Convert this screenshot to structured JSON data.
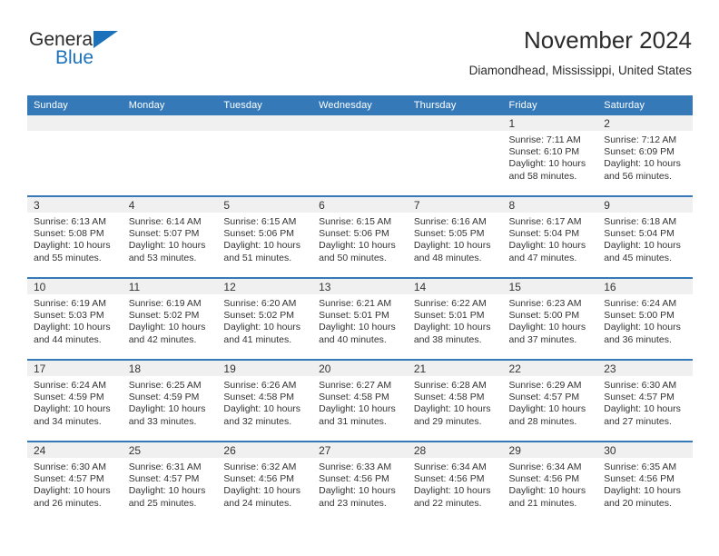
{
  "logo": {
    "word_top": "General",
    "word_bottom": "Blue",
    "triangle_color": "#1b72bb"
  },
  "header": {
    "title": "November 2024",
    "subtitle": "Diamondhead, Mississippi, United States"
  },
  "theme": {
    "header_blue": "#3579b8",
    "daybar_gray": "#f0f0f0",
    "text": "#333333"
  },
  "calendar": {
    "weekday_headers": [
      "Sunday",
      "Monday",
      "Tuesday",
      "Wednesday",
      "Thursday",
      "Friday",
      "Saturday"
    ],
    "labels": {
      "sunrise": "Sunrise:",
      "sunset": "Sunset:",
      "daylight": "Daylight:"
    },
    "weeks": [
      [
        {
          "day": "",
          "sunrise": "",
          "sunset": "",
          "daylight": ""
        },
        {
          "day": "",
          "sunrise": "",
          "sunset": "",
          "daylight": ""
        },
        {
          "day": "",
          "sunrise": "",
          "sunset": "",
          "daylight": ""
        },
        {
          "day": "",
          "sunrise": "",
          "sunset": "",
          "daylight": ""
        },
        {
          "day": "",
          "sunrise": "",
          "sunset": "",
          "daylight": ""
        },
        {
          "day": "1",
          "sunrise": "Sunrise: 7:11 AM",
          "sunset": "Sunset: 6:10 PM",
          "daylight": "Daylight: 10 hours and 58 minutes."
        },
        {
          "day": "2",
          "sunrise": "Sunrise: 7:12 AM",
          "sunset": "Sunset: 6:09 PM",
          "daylight": "Daylight: 10 hours and 56 minutes."
        }
      ],
      [
        {
          "day": "3",
          "sunrise": "Sunrise: 6:13 AM",
          "sunset": "Sunset: 5:08 PM",
          "daylight": "Daylight: 10 hours and 55 minutes."
        },
        {
          "day": "4",
          "sunrise": "Sunrise: 6:14 AM",
          "sunset": "Sunset: 5:07 PM",
          "daylight": "Daylight: 10 hours and 53 minutes."
        },
        {
          "day": "5",
          "sunrise": "Sunrise: 6:15 AM",
          "sunset": "Sunset: 5:06 PM",
          "daylight": "Daylight: 10 hours and 51 minutes."
        },
        {
          "day": "6",
          "sunrise": "Sunrise: 6:15 AM",
          "sunset": "Sunset: 5:06 PM",
          "daylight": "Daylight: 10 hours and 50 minutes."
        },
        {
          "day": "7",
          "sunrise": "Sunrise: 6:16 AM",
          "sunset": "Sunset: 5:05 PM",
          "daylight": "Daylight: 10 hours and 48 minutes."
        },
        {
          "day": "8",
          "sunrise": "Sunrise: 6:17 AM",
          "sunset": "Sunset: 5:04 PM",
          "daylight": "Daylight: 10 hours and 47 minutes."
        },
        {
          "day": "9",
          "sunrise": "Sunrise: 6:18 AM",
          "sunset": "Sunset: 5:04 PM",
          "daylight": "Daylight: 10 hours and 45 minutes."
        }
      ],
      [
        {
          "day": "10",
          "sunrise": "Sunrise: 6:19 AM",
          "sunset": "Sunset: 5:03 PM",
          "daylight": "Daylight: 10 hours and 44 minutes."
        },
        {
          "day": "11",
          "sunrise": "Sunrise: 6:19 AM",
          "sunset": "Sunset: 5:02 PM",
          "daylight": "Daylight: 10 hours and 42 minutes."
        },
        {
          "day": "12",
          "sunrise": "Sunrise: 6:20 AM",
          "sunset": "Sunset: 5:02 PM",
          "daylight": "Daylight: 10 hours and 41 minutes."
        },
        {
          "day": "13",
          "sunrise": "Sunrise: 6:21 AM",
          "sunset": "Sunset: 5:01 PM",
          "daylight": "Daylight: 10 hours and 40 minutes."
        },
        {
          "day": "14",
          "sunrise": "Sunrise: 6:22 AM",
          "sunset": "Sunset: 5:01 PM",
          "daylight": "Daylight: 10 hours and 38 minutes."
        },
        {
          "day": "15",
          "sunrise": "Sunrise: 6:23 AM",
          "sunset": "Sunset: 5:00 PM",
          "daylight": "Daylight: 10 hours and 37 minutes."
        },
        {
          "day": "16",
          "sunrise": "Sunrise: 6:24 AM",
          "sunset": "Sunset: 5:00 PM",
          "daylight": "Daylight: 10 hours and 36 minutes."
        }
      ],
      [
        {
          "day": "17",
          "sunrise": "Sunrise: 6:24 AM",
          "sunset": "Sunset: 4:59 PM",
          "daylight": "Daylight: 10 hours and 34 minutes."
        },
        {
          "day": "18",
          "sunrise": "Sunrise: 6:25 AM",
          "sunset": "Sunset: 4:59 PM",
          "daylight": "Daylight: 10 hours and 33 minutes."
        },
        {
          "day": "19",
          "sunrise": "Sunrise: 6:26 AM",
          "sunset": "Sunset: 4:58 PM",
          "daylight": "Daylight: 10 hours and 32 minutes."
        },
        {
          "day": "20",
          "sunrise": "Sunrise: 6:27 AM",
          "sunset": "Sunset: 4:58 PM",
          "daylight": "Daylight: 10 hours and 31 minutes."
        },
        {
          "day": "21",
          "sunrise": "Sunrise: 6:28 AM",
          "sunset": "Sunset: 4:58 PM",
          "daylight": "Daylight: 10 hours and 29 minutes."
        },
        {
          "day": "22",
          "sunrise": "Sunrise: 6:29 AM",
          "sunset": "Sunset: 4:57 PM",
          "daylight": "Daylight: 10 hours and 28 minutes."
        },
        {
          "day": "23",
          "sunrise": "Sunrise: 6:30 AM",
          "sunset": "Sunset: 4:57 PM",
          "daylight": "Daylight: 10 hours and 27 minutes."
        }
      ],
      [
        {
          "day": "24",
          "sunrise": "Sunrise: 6:30 AM",
          "sunset": "Sunset: 4:57 PM",
          "daylight": "Daylight: 10 hours and 26 minutes."
        },
        {
          "day": "25",
          "sunrise": "Sunrise: 6:31 AM",
          "sunset": "Sunset: 4:57 PM",
          "daylight": "Daylight: 10 hours and 25 minutes."
        },
        {
          "day": "26",
          "sunrise": "Sunrise: 6:32 AM",
          "sunset": "Sunset: 4:56 PM",
          "daylight": "Daylight: 10 hours and 24 minutes."
        },
        {
          "day": "27",
          "sunrise": "Sunrise: 6:33 AM",
          "sunset": "Sunset: 4:56 PM",
          "daylight": "Daylight: 10 hours and 23 minutes."
        },
        {
          "day": "28",
          "sunrise": "Sunrise: 6:34 AM",
          "sunset": "Sunset: 4:56 PM",
          "daylight": "Daylight: 10 hours and 22 minutes."
        },
        {
          "day": "29",
          "sunrise": "Sunrise: 6:34 AM",
          "sunset": "Sunset: 4:56 PM",
          "daylight": "Daylight: 10 hours and 21 minutes."
        },
        {
          "day": "30",
          "sunrise": "Sunrise: 6:35 AM",
          "sunset": "Sunset: 4:56 PM",
          "daylight": "Daylight: 10 hours and 20 minutes."
        }
      ]
    ]
  }
}
